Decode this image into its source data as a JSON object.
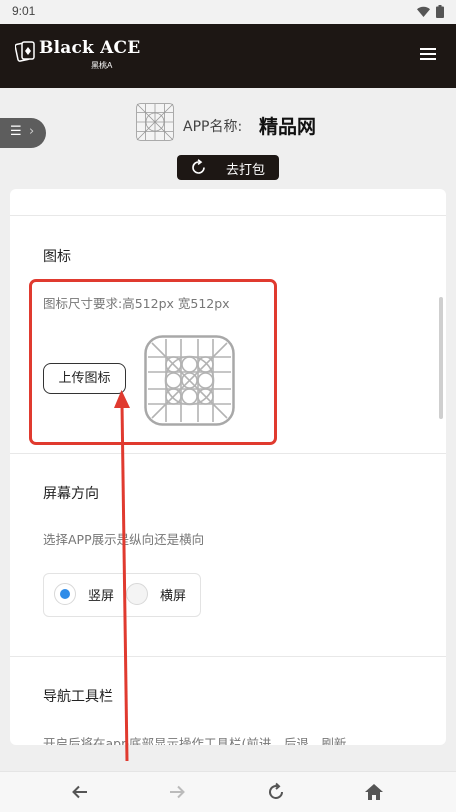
{
  "status_bar": {
    "time": "9:01"
  },
  "brand": {
    "name": "Black ACE",
    "subtitle": "黑桃A"
  },
  "app": {
    "label": "APP名称:",
    "name": "精品网"
  },
  "pack_button": {
    "label": "去打包"
  },
  "icon_section": {
    "title": "图标",
    "requirement": "图标尺寸要求:高512px 宽512px",
    "upload_label": "上传图标"
  },
  "orientation_section": {
    "title": "屏幕方向",
    "description": "选择APP展示是纵向还是横向",
    "options": [
      {
        "label": "竖屏",
        "selected": true
      },
      {
        "label": "横屏",
        "selected": false
      }
    ]
  },
  "toolbar_section": {
    "title": "导航工具栏",
    "description": "开启后将在app底部显示操作工具栏(前进、后退、刷新、"
  },
  "bottom_nav": {
    "icons": [
      "back-arrow-icon",
      "forward-arrow-icon",
      "refresh-icon",
      "home-icon"
    ]
  },
  "colors": {
    "header": "#1d1714",
    "accent_radio": "#2f8ce8",
    "annotation": "#e03a2f"
  }
}
